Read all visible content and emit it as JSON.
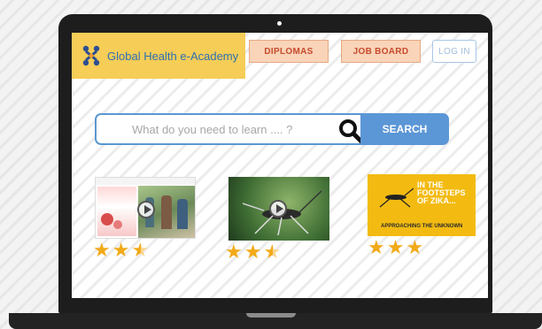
{
  "logo": {
    "text": "Global Health e-Academy",
    "icon": "people-network-icon"
  },
  "nav": {
    "diplomas": "DIPLOMAS",
    "job_board": "JOB BOARD",
    "login": "LOG IN"
  },
  "search": {
    "placeholder": "What do you need to learn .... ?",
    "button": "SEARCH"
  },
  "courses": [
    {
      "rating": 2.5,
      "thumb_icon": "video-play-icon"
    },
    {
      "rating": 2.5,
      "thumb_icon": "video-play-icon"
    },
    {
      "rating": 3,
      "thumb_text": [
        "IN THE",
        "FOOTSTEPS",
        "OF ZIKA..."
      ],
      "thumb_subtitle": "APPROACHING THE UNKNOWN"
    }
  ],
  "colors": {
    "logo_bg": "#f5cd57",
    "nav_bg": "#f9d4b8",
    "nav_text": "#c64a2d",
    "search_blue": "#5b96d6",
    "star": "#f2aa19"
  }
}
